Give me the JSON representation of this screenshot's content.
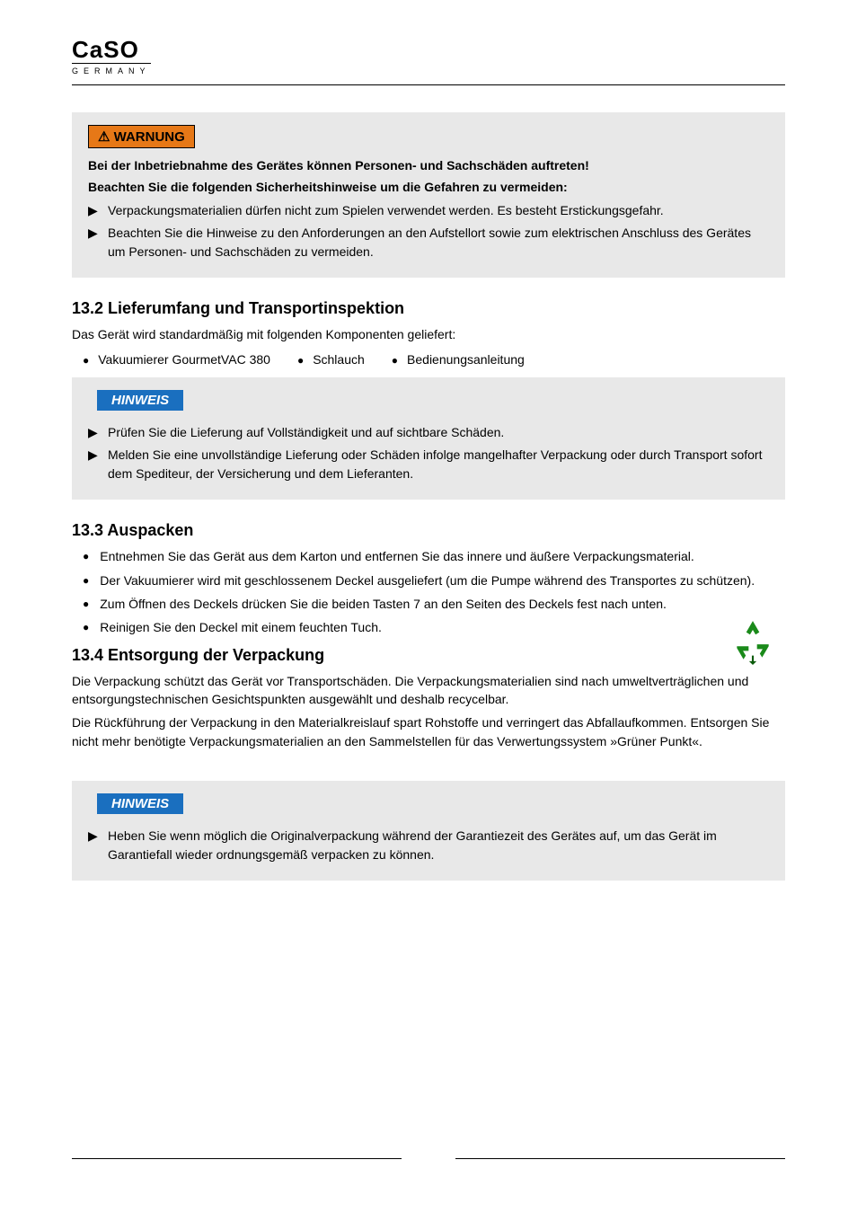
{
  "brand": {
    "name": "CaSO",
    "country": "GERMANY"
  },
  "warnung_badge": "⚠ WARNUNG",
  "hinweis_badge": "HINWEIS",
  "warn1": {
    "line1": "Bei der Inbetriebnahme des Gerätes können Personen- und Sachschäden auftreten!",
    "line2": "Beachten Sie die folgenden Sicherheitshinweise um die Gefahren zu vermeiden:",
    "bullets": [
      "Verpackungsmaterialien dürfen nicht zum Spielen verwendet werden. Es besteht Erstickungsgefahr.",
      "Beachten Sie die Hinweise zu den Anforderungen an den Aufstellort sowie zum elektrischen Anschluss des Gerätes um Personen- und Sachschäden zu vermeiden."
    ]
  },
  "sec_liefer": {
    "title": "13.2 Lieferumfang und Transportinspektion",
    "intro": "Das Gerät wird standardmäßig mit folgenden Komponenten geliefert:",
    "items": [
      "Vakuumierer GourmetVAC 380",
      "Schlauch",
      "Bedienungsanleitung"
    ]
  },
  "note1": {
    "bullets": [
      "Prüfen Sie die Lieferung auf Vollständigkeit und auf sichtbare Schäden.",
      "Melden Sie eine unvollständige Lieferung oder Schäden infolge mangelhafter Verpackung oder durch Transport sofort dem Spediteur, der Versicherung und dem Lieferanten."
    ]
  },
  "sec_auspack": {
    "title": "13.3 Auspacken",
    "bullets": [
      "Entnehmen Sie das Gerät aus dem Karton und entfernen Sie das innere und äußere Verpackungsmaterial.",
      "Der Vakuumierer wird mit geschlossenem Deckel ausgeliefert (um die Pumpe während des Transportes zu schützen).",
      "Zum Öffnen des Deckels drücken Sie die beiden Tasten 7 an den Seiten des Deckels fest nach unten.",
      "Reinigen Sie den Deckel mit einem feuchten Tuch."
    ]
  },
  "sec_verpack": {
    "title": "13.4 Entsorgung der Verpackung",
    "paras": [
      "Die Verpackung schützt das Gerät vor Transportschäden. Die Verpackungsmaterialien sind nach umweltverträglichen und entsorgungstechnischen Gesichtspunkten ausgewählt und deshalb recycelbar.",
      "Die Rückführung der Verpackung in den Materialkreislauf spart Rohstoffe und verringert das Abfallaufkommen. Entsorgen Sie nicht mehr benötigte Verpackungsmaterialien an den Sammelstellen für das Verwertungssystem »Grüner Punkt«."
    ]
  },
  "note2": {
    "bullets": [
      "Heben Sie wenn möglich die Originalverpackung während der Garantiezeit des Gerätes auf, um das Gerät im Garantiefall wieder ordnungsgemäß verpacken zu können."
    ]
  }
}
